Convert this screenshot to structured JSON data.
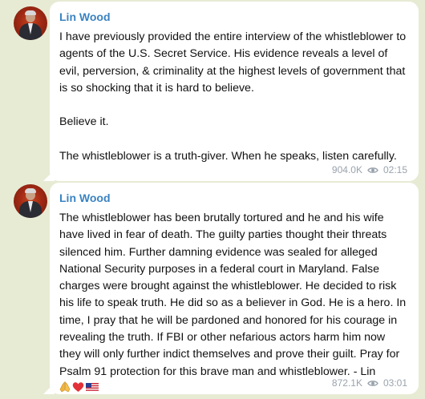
{
  "messages": [
    {
      "author": "Lin Wood",
      "text": "I have previously provided the entire interview of the whistleblower to agents of the U.S. Secret Service. His evidence reveals a level of evil, perversion, & criminality at the highest levels of government that is so shocking that it is hard to believe.\n\nBelieve it.\n\nThe whistleblower is a truth-giver. When he speaks, listen carefully.",
      "views": "904.0K",
      "time": "02:15"
    },
    {
      "author": "Lin Wood",
      "text": "The whistleblower has been brutally tortured and he and his wife have lived in fear of death. The guilty parties thought their threats silenced him. Further damning evidence was sealed for alleged National Security purposes in a federal court in Maryland. False charges were brought against the whistleblower. He decided to risk his life to speak truth. He did so as a believer in God. He is a hero. In time, I pray that he will be pardoned and honored for his courage in revealing the truth. If FBI or other nefarious actors harm him now they will only further indict themselves and prove their guilt. Pray for Psalm 91 protection for this brave man and whistleblower. - Lin",
      "emoji": [
        "folded-hands-emoji",
        "red-heart-emoji",
        "us-flag-emoji"
      ],
      "views": "872.1K",
      "time": "03:01"
    }
  ],
  "icons": {
    "views": "eye-icon"
  },
  "colors": {
    "background": "#e7ebd4",
    "author": "#3a83c1",
    "meta": "#9aa3ad",
    "bubble": "#ffffff"
  }
}
